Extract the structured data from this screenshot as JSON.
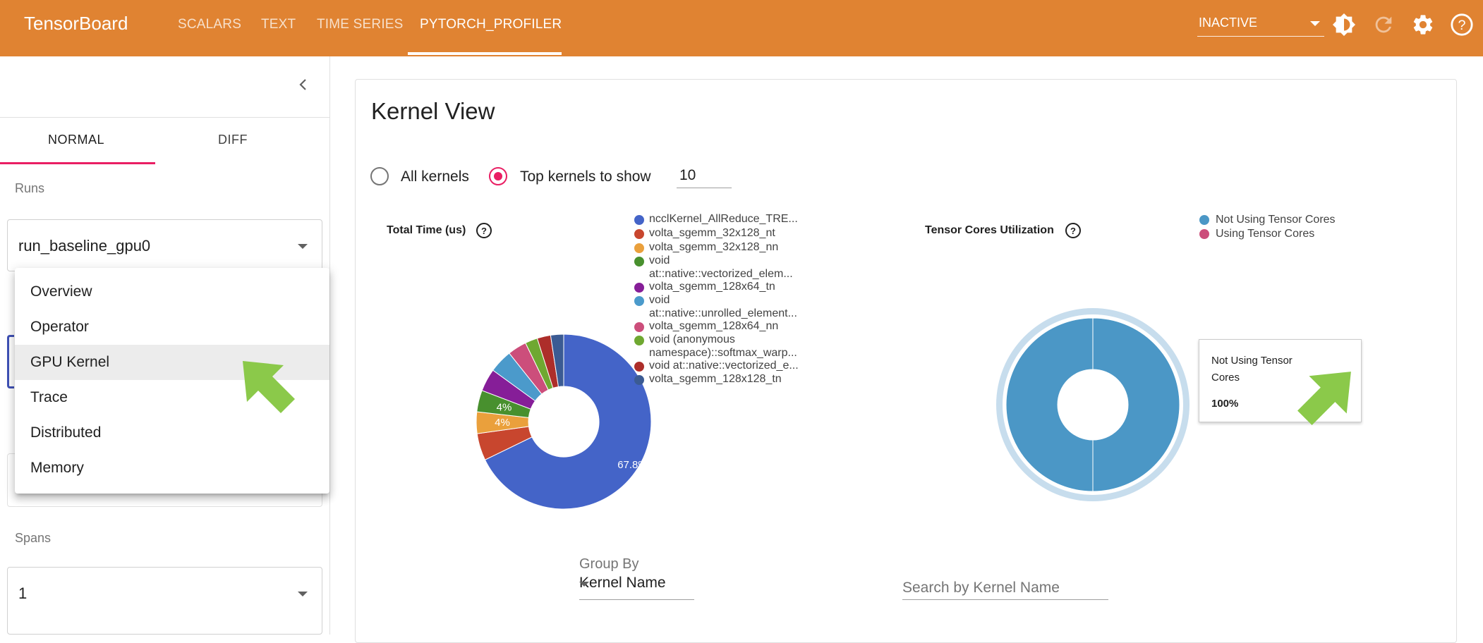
{
  "app": {
    "title": "TensorBoard",
    "nav_tabs": [
      {
        "label": "SCALARS"
      },
      {
        "label": "TEXT"
      },
      {
        "label": "TIME SERIES"
      },
      {
        "label": "PYTORCH_PROFILER",
        "active": true
      }
    ],
    "run_status": "INACTIVE",
    "accent_color": "#e08332",
    "icons": [
      "brightness-icon",
      "refresh-icon",
      "settings-icon",
      "help-icon"
    ]
  },
  "sidebar": {
    "tabs": [
      "NORMAL",
      "DIFF"
    ],
    "active_tab": "NORMAL",
    "runs_label": "Runs",
    "run_value": "run_baseline_gpu0",
    "spans_label": "Spans",
    "spans_value": "1",
    "view_menu": {
      "items": [
        "Overview",
        "Operator",
        "GPU Kernel",
        "Trace",
        "Distributed",
        "Memory"
      ],
      "selected": "GPU Kernel"
    }
  },
  "main": {
    "title": "Kernel View",
    "radio_all": "All kernels",
    "radio_top": "Top kernels to show",
    "radio_selected": "Top kernels to show",
    "top_k_value": "10",
    "group_by_label": "Group By",
    "group_by_value": "Kernel Name",
    "search_placeholder": "Search by Kernel Name"
  },
  "chart_data": [
    {
      "type": "pie",
      "title": "Total Time (us)",
      "donut": true,
      "legend_position": "right",
      "categories": [
        "ncclKernel_AllReduce_TRE...",
        "volta_sgemm_32x128_nt",
        "volta_sgemm_32x128_nn",
        "void at::native::vectorized_elem...",
        "volta_sgemm_128x64_tn",
        "void at::native::unrolled_element...",
        "volta_sgemm_128x64_nn",
        "void (anonymous namespace)::softmax_warp...",
        "void at::native::vectorized_e...",
        "volta_sgemm_128x128_tn"
      ],
      "values": [
        67.8,
        5,
        4,
        4,
        4.2,
        4.3,
        3.5,
        2.3,
        2.5,
        2.4
      ],
      "value_labels": [
        "67.8%",
        "",
        "4%",
        "4%",
        "",
        "",
        "",
        "",
        "",
        ""
      ],
      "colors": [
        "#4464c8",
        "#c8462e",
        "#eaa03c",
        "#48902e",
        "#861e98",
        "#4b9acb",
        "#cc4e7b",
        "#6fa831",
        "#ad2e2a",
        "#3b5b93"
      ]
    },
    {
      "type": "pie",
      "title": "Tensor Cores Utilization",
      "donut": true,
      "legend_position": "top-right",
      "categories": [
        "Not Using Tensor Cores",
        "Using Tensor Cores"
      ],
      "values": [
        100,
        0
      ],
      "colors": [
        "#4b97c6",
        "#cc4e7b"
      ],
      "tooltip": {
        "name": "Not Using Tensor Cores",
        "value": "100%"
      }
    }
  ]
}
